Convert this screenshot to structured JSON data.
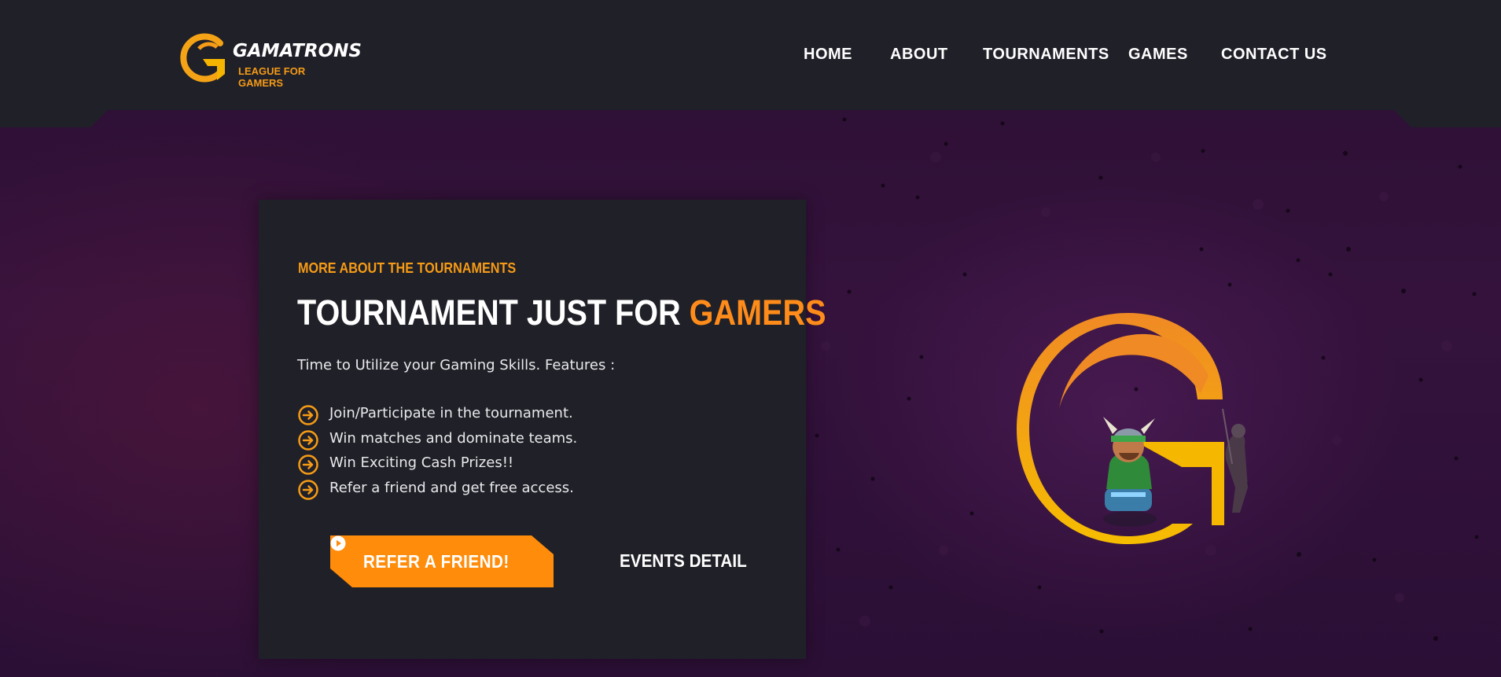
{
  "brand": {
    "name": "GAMATRONS",
    "tagline": "LEAGUE FOR GAMERS"
  },
  "nav": {
    "items": [
      {
        "label": "HOME"
      },
      {
        "label": "ABOUT"
      },
      {
        "label": "TOURNAMENTS"
      },
      {
        "label": "GAMES"
      },
      {
        "label": "CONTACT US"
      }
    ]
  },
  "hero": {
    "eyebrow": "MORE ABOUT THE TOURNAMENTS",
    "title_main": "TOURNAMENT JUST FOR ",
    "title_accent": "GAMERS",
    "subtitle": "Time to Utilize your Gaming Skills. Features :",
    "features": [
      "Join/Participate in the tournament.",
      "Win matches and dominate teams.",
      "Win Exciting Cash Prizes!!",
      "Refer a friend and get free access."
    ],
    "primary_button": "REFER A FRIEND!",
    "secondary_button": "EVENTS DETAIL"
  },
  "icons": {
    "logo": "gamatrons-g-logo",
    "feature_bullet": "arrow-circle-right-icon",
    "button_icon": "play-circle-icon",
    "hero_art": "g-logo-with-game-characters"
  },
  "colors": {
    "accent": "#ff8c1a",
    "header_bg": "#202029",
    "card_bg": "#202028",
    "hero_bg": "#2c0f32",
    "text": "#ffffff"
  }
}
